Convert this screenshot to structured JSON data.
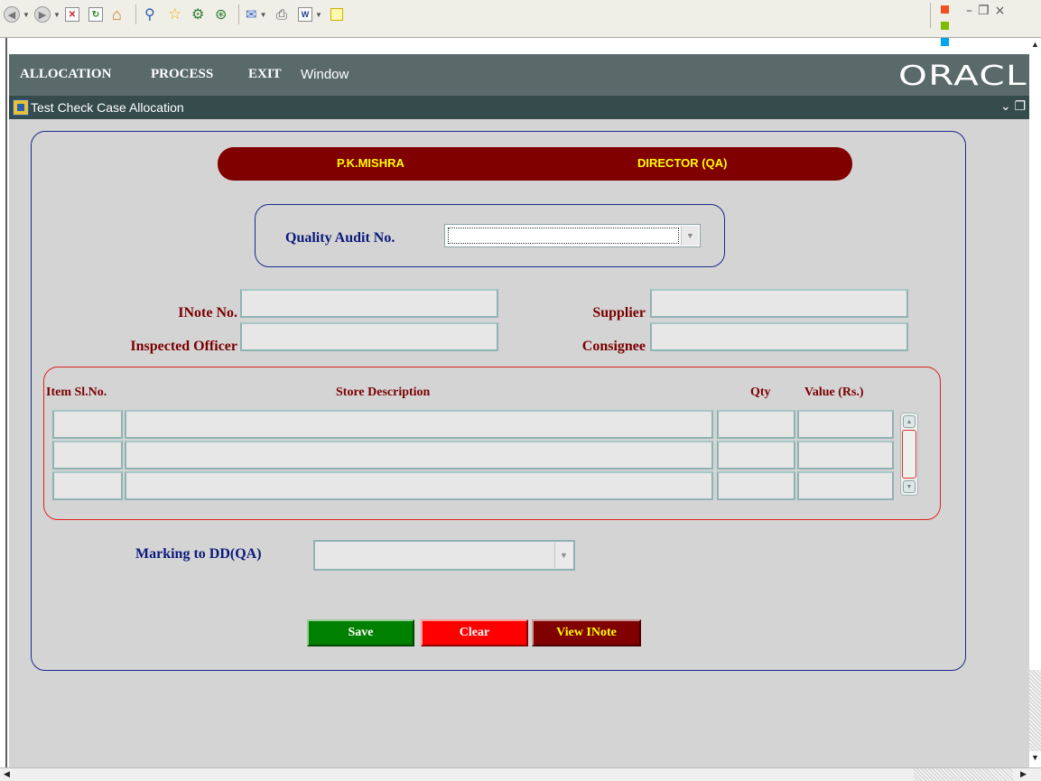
{
  "menu": {
    "items": [
      {
        "label": "ALLOCATION"
      },
      {
        "label": "PROCESS"
      },
      {
        "label": "EXIT"
      },
      {
        "label": "Window"
      }
    ],
    "brand": "ORACLE"
  },
  "window": {
    "title": "Test Check Case Allocation"
  },
  "user_banner": {
    "name": "P.K.MISHRA",
    "role": "DIRECTOR (QA)"
  },
  "form": {
    "quality_audit_label": "Quality Audit No.",
    "quality_audit_value": "",
    "inote_label": "INote No.",
    "inote_value": "",
    "inspected_officer_label": "Inspected Officer",
    "inspected_officer_value": "",
    "supplier_label": "Supplier",
    "supplier_value": "",
    "consignee_label": "Consignee",
    "consignee_value": "",
    "marking_label": "Marking to DD(QA)",
    "marking_value": ""
  },
  "items_table": {
    "columns": [
      "Item Sl.No.",
      "Store Description",
      "Qty",
      "Value (Rs.)"
    ],
    "rows": [
      {
        "item_sl_no": "",
        "store_description": "",
        "qty": "",
        "value": ""
      },
      {
        "item_sl_no": "",
        "store_description": "",
        "qty": "",
        "value": ""
      },
      {
        "item_sl_no": "",
        "store_description": "",
        "qty": "",
        "value": ""
      }
    ]
  },
  "buttons": {
    "save": "Save",
    "clear": "Clear",
    "view_inote": "View INote"
  },
  "colors": {
    "banner": "#800000",
    "banner_text": "#ffff00",
    "save_button": "#008000",
    "clear_button": "#ff0000",
    "view_inote_button": "#800000",
    "menubar": "#5a6a6b",
    "titlebar": "#354b4c",
    "canvas": "#d4d4d4"
  }
}
